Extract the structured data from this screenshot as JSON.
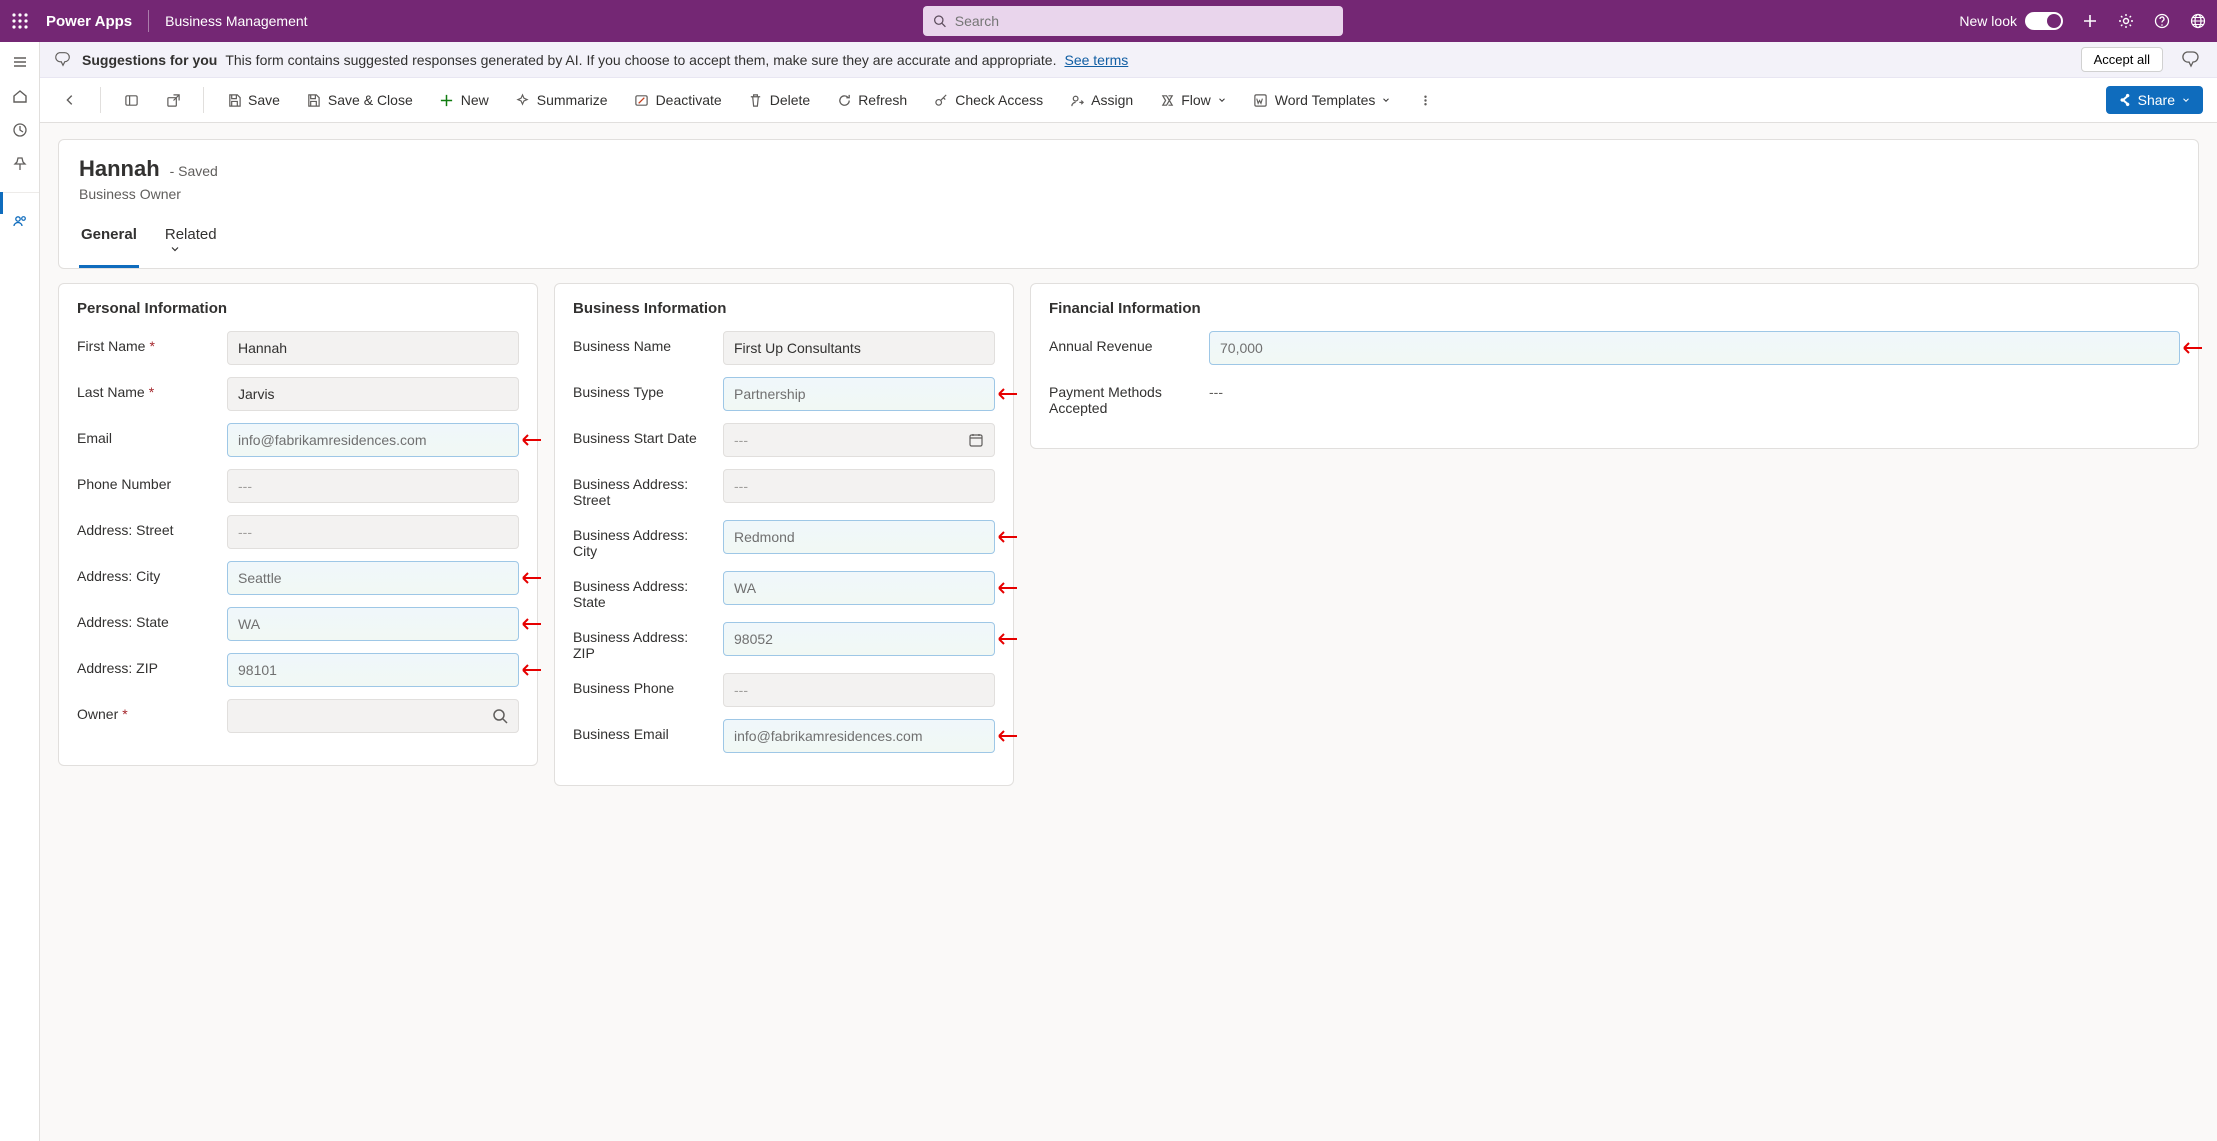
{
  "topbar": {
    "app_name": "Power Apps",
    "environment": "Business Management",
    "search_placeholder": "Search",
    "newlook_label": "New look"
  },
  "suggestion_banner": {
    "label_bold": "Suggestions for you",
    "text": "This form contains suggested responses generated by AI. If you choose to accept them, make sure they are accurate and appropriate.",
    "see_terms": "See terms",
    "accept_all": "Accept all"
  },
  "cmdbar": {
    "save": "Save",
    "save_close": "Save & Close",
    "new": "New",
    "summarize": "Summarize",
    "deactivate": "Deactivate",
    "delete": "Delete",
    "refresh": "Refresh",
    "check_access": "Check Access",
    "assign": "Assign",
    "flow": "Flow",
    "word_templates": "Word Templates",
    "share": "Share"
  },
  "header": {
    "title": "Hannah",
    "saved_suffix": "- Saved",
    "subtitle": "Business Owner"
  },
  "tabs": {
    "general": "General",
    "related": "Related"
  },
  "sections": {
    "personal": {
      "title": "Personal Information",
      "fields": {
        "first_name_label": "First Name",
        "first_name_value": "Hannah",
        "last_name_label": "Last Name",
        "last_name_value": "Jarvis",
        "email_label": "Email",
        "email_value": "info@fabrikamresidences.com",
        "phone_label": "Phone Number",
        "phone_value": "---",
        "street_label": "Address: Street",
        "street_value": "---",
        "city_label": "Address: City",
        "city_value": "Seattle",
        "state_label": "Address: State",
        "state_value": "WA",
        "zip_label": "Address: ZIP",
        "zip_value": "98101",
        "owner_label": "Owner",
        "owner_value": ""
      }
    },
    "business": {
      "title": "Business Information",
      "fields": {
        "name_label": "Business Name",
        "name_value": "First Up Consultants",
        "type_label": "Business Type",
        "type_value": "Partnership",
        "start_label": "Business Start Date",
        "start_value": "---",
        "street_label": "Business Address: Street",
        "street_value": "---",
        "city_label": "Business Address: City",
        "city_value": "Redmond",
        "state_label": "Business Address: State",
        "state_value": "WA",
        "zip_label": "Business Address: ZIP",
        "zip_value": "98052",
        "phone_label": "Business Phone",
        "phone_value": "---",
        "email_label": "Business Email",
        "email_value": "info@fabrikamresidences.com"
      }
    },
    "financial": {
      "title": "Financial Information",
      "fields": {
        "revenue_label": "Annual Revenue",
        "revenue_value": "70,000",
        "paymethods_label": "Payment Methods Accepted",
        "paymethods_value": "---"
      }
    }
  }
}
